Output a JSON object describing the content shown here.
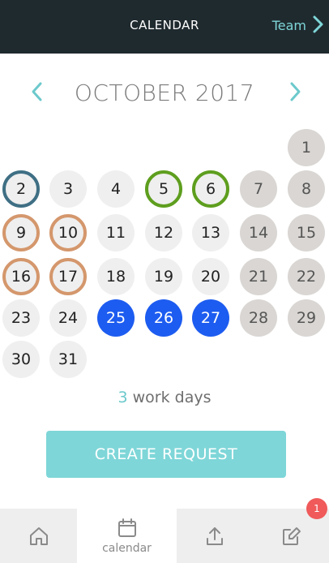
{
  "header": {
    "title": "CALENDAR",
    "team_label": "Team"
  },
  "month": {
    "label": "OCTOBER 2017"
  },
  "days": [
    {
      "n": "1",
      "kind": "weekend"
    },
    {
      "n": "2",
      "kind": "today"
    },
    {
      "n": "3",
      "kind": "normal"
    },
    {
      "n": "4",
      "kind": "normal"
    },
    {
      "n": "5",
      "kind": "green"
    },
    {
      "n": "6",
      "kind": "green"
    },
    {
      "n": "7",
      "kind": "weekend"
    },
    {
      "n": "8",
      "kind": "weekend"
    },
    {
      "n": "9",
      "kind": "orange"
    },
    {
      "n": "10",
      "kind": "orange"
    },
    {
      "n": "11",
      "kind": "normal"
    },
    {
      "n": "12",
      "kind": "normal"
    },
    {
      "n": "13",
      "kind": "normal"
    },
    {
      "n": "14",
      "kind": "weekend"
    },
    {
      "n": "15",
      "kind": "weekend"
    },
    {
      "n": "16",
      "kind": "orange"
    },
    {
      "n": "17",
      "kind": "orange"
    },
    {
      "n": "18",
      "kind": "normal"
    },
    {
      "n": "19",
      "kind": "normal"
    },
    {
      "n": "20",
      "kind": "normal"
    },
    {
      "n": "21",
      "kind": "weekend"
    },
    {
      "n": "22",
      "kind": "weekend"
    },
    {
      "n": "23",
      "kind": "normal"
    },
    {
      "n": "24",
      "kind": "normal"
    },
    {
      "n": "25",
      "kind": "selected"
    },
    {
      "n": "26",
      "kind": "selected"
    },
    {
      "n": "27",
      "kind": "selected"
    },
    {
      "n": "28",
      "kind": "weekend"
    },
    {
      "n": "29",
      "kind": "weekend"
    },
    {
      "n": "30",
      "kind": "normal"
    },
    {
      "n": "31",
      "kind": "normal"
    }
  ],
  "summary": {
    "count": "3",
    "label": "work days"
  },
  "actions": {
    "create_label": "CREATE REQUEST"
  },
  "bottom_nav": {
    "calendar_label": "calendar",
    "badge_count": "1"
  },
  "colors": {
    "header_bg": "#1f2a2f",
    "accent": "#7ed6d8",
    "selected": "#1d5cf0",
    "today_ring": "#3f6f84",
    "green_ring": "#5e9e1e",
    "orange_ring": "#d4976c",
    "badge": "#f05a5a"
  }
}
